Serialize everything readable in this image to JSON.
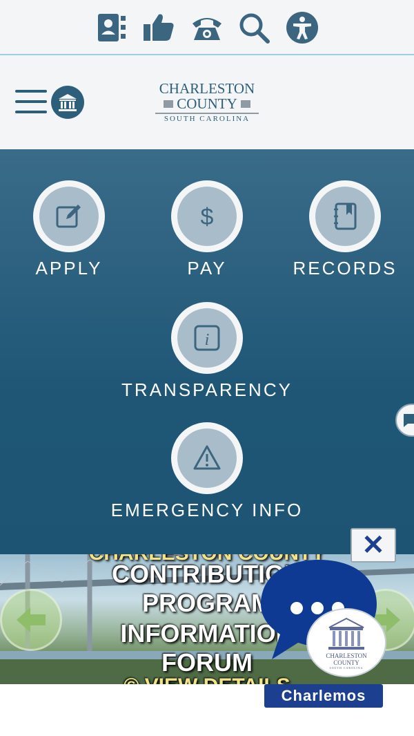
{
  "topbar": {
    "icons": [
      "contact-directory-icon",
      "thumbs-up-icon",
      "phone-icon",
      "search-icon",
      "accessibility-icon"
    ]
  },
  "header": {
    "logo": {
      "line1": "CHARLESTON",
      "line2": "COUNTY",
      "line3": "SOUTH CAROLINA"
    },
    "menu_icon": "hamburger-menu-icon",
    "government_icon": "government-building-icon"
  },
  "quick_links": [
    {
      "label": "APPLY",
      "icon": "edit-icon"
    },
    {
      "label": "PAY",
      "icon": "dollar-icon"
    },
    {
      "label": "RECORDS",
      "icon": "notebook-icon"
    },
    {
      "label": "TRANSPARENCY",
      "icon": "info-icon"
    },
    {
      "label": "EMERGENCY INFO",
      "icon": "warning-icon"
    }
  ],
  "banner": {
    "line0": "CHARLESTON COUNTY",
    "line1": "CONTRIBUTION",
    "line2": "PROGRAM",
    "line3": "INFORMATION",
    "line4": "FORUM",
    "line5": "© VIEW DETAILS"
  },
  "chat": {
    "close_label": "✕",
    "name": "Charlemos",
    "logo_line1": "CHARLESTON",
    "logo_line2": "COUNTY",
    "logo_line3": "SOUTH CAROLINA",
    "bubble_color": "#0f3a93"
  },
  "colors": {
    "primary": "#2d5f7b",
    "hero": "#1f5676",
    "accent": "#1d3f8f",
    "circle_inner": "#a9bcc9"
  }
}
